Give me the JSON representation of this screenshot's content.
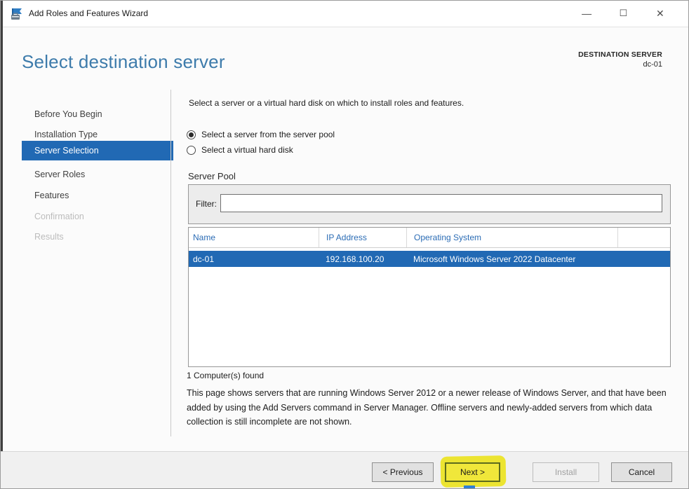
{
  "window": {
    "title": "Add Roles and Features Wizard",
    "controls": {
      "minimize": "—",
      "maximize": "☐",
      "close": "✕"
    }
  },
  "header": {
    "title": "Select destination server",
    "destination": {
      "label": "DESTINATION SERVER",
      "value": "dc-01"
    }
  },
  "sidebar": {
    "items": [
      {
        "label": "Before You Begin",
        "state": "enabled"
      },
      {
        "label": "Installation Type",
        "state": "enabled"
      },
      {
        "label": "Server Selection",
        "state": "selected"
      },
      {
        "label": "Server Roles",
        "state": "enabled"
      },
      {
        "label": "Features",
        "state": "enabled"
      },
      {
        "label": "Confirmation",
        "state": "disabled"
      },
      {
        "label": "Results",
        "state": "disabled"
      }
    ]
  },
  "main": {
    "intro": "Select a server or a virtual hard disk on which to install roles and features.",
    "radios": [
      {
        "label": "Select a server from the server pool",
        "selected": true
      },
      {
        "label": "Select a virtual hard disk",
        "selected": false
      }
    ],
    "server_pool": {
      "label": "Server Pool",
      "filter_label": "Filter:",
      "filter_value": "",
      "columns": [
        "Name",
        "IP Address",
        "Operating System"
      ],
      "rows": [
        [
          "dc-01",
          "192.168.100.20",
          "Microsoft Windows Server 2022 Datacenter"
        ]
      ],
      "found_text": "1 Computer(s) found"
    },
    "description": "This page shows servers that are running Windows Server 2012 or a newer release of Windows Server, and that have been added by using the Add Servers command in Server Manager. Offline servers and newly-added servers from which data collection is still incomplete are not shown."
  },
  "footer": {
    "buttons": [
      {
        "label": "< Previous",
        "state": "enabled"
      },
      {
        "label": "Next >",
        "state": "default-highlighted"
      },
      {
        "label": "Install",
        "state": "disabled"
      },
      {
        "label": "Cancel",
        "state": "enabled"
      }
    ]
  },
  "colors": {
    "accent_blue": "#2169b4",
    "header_title_blue": "#3d7bab",
    "column_link_blue": "#2b6cb5",
    "highlight_yellow": "#ece431"
  }
}
